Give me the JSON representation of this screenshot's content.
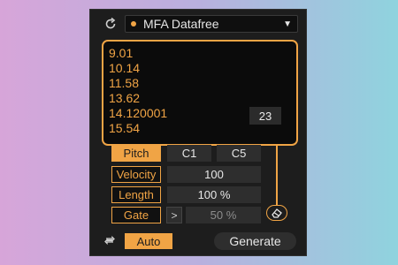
{
  "header": {
    "preset_name": "MFA Datafree"
  },
  "values": [
    "9.01",
    "10.14",
    "11.58",
    "13.62",
    "14.120001",
    "15.54"
  ],
  "count": "23",
  "params": {
    "pitch": {
      "label": "Pitch",
      "low": "C1",
      "high": "C5"
    },
    "velocity": {
      "label": "Velocity",
      "value": "100"
    },
    "length": {
      "label": "Length",
      "value": "100 %"
    },
    "gate": {
      "label": "Gate",
      "arrow": ">",
      "value": "50 %"
    }
  },
  "footer": {
    "auto_label": "Auto",
    "generate_label": "Generate"
  },
  "colors": {
    "accent": "#f0a445",
    "panel": "#1d1d1d",
    "field": "#2e2e2e"
  },
  "icons": {
    "cycle": "refresh-icon",
    "preset_dot": "preset-dot-icon",
    "dropdown": "chevron-down-icon",
    "eraser": "eraser-icon",
    "loop": "loop-icon"
  }
}
